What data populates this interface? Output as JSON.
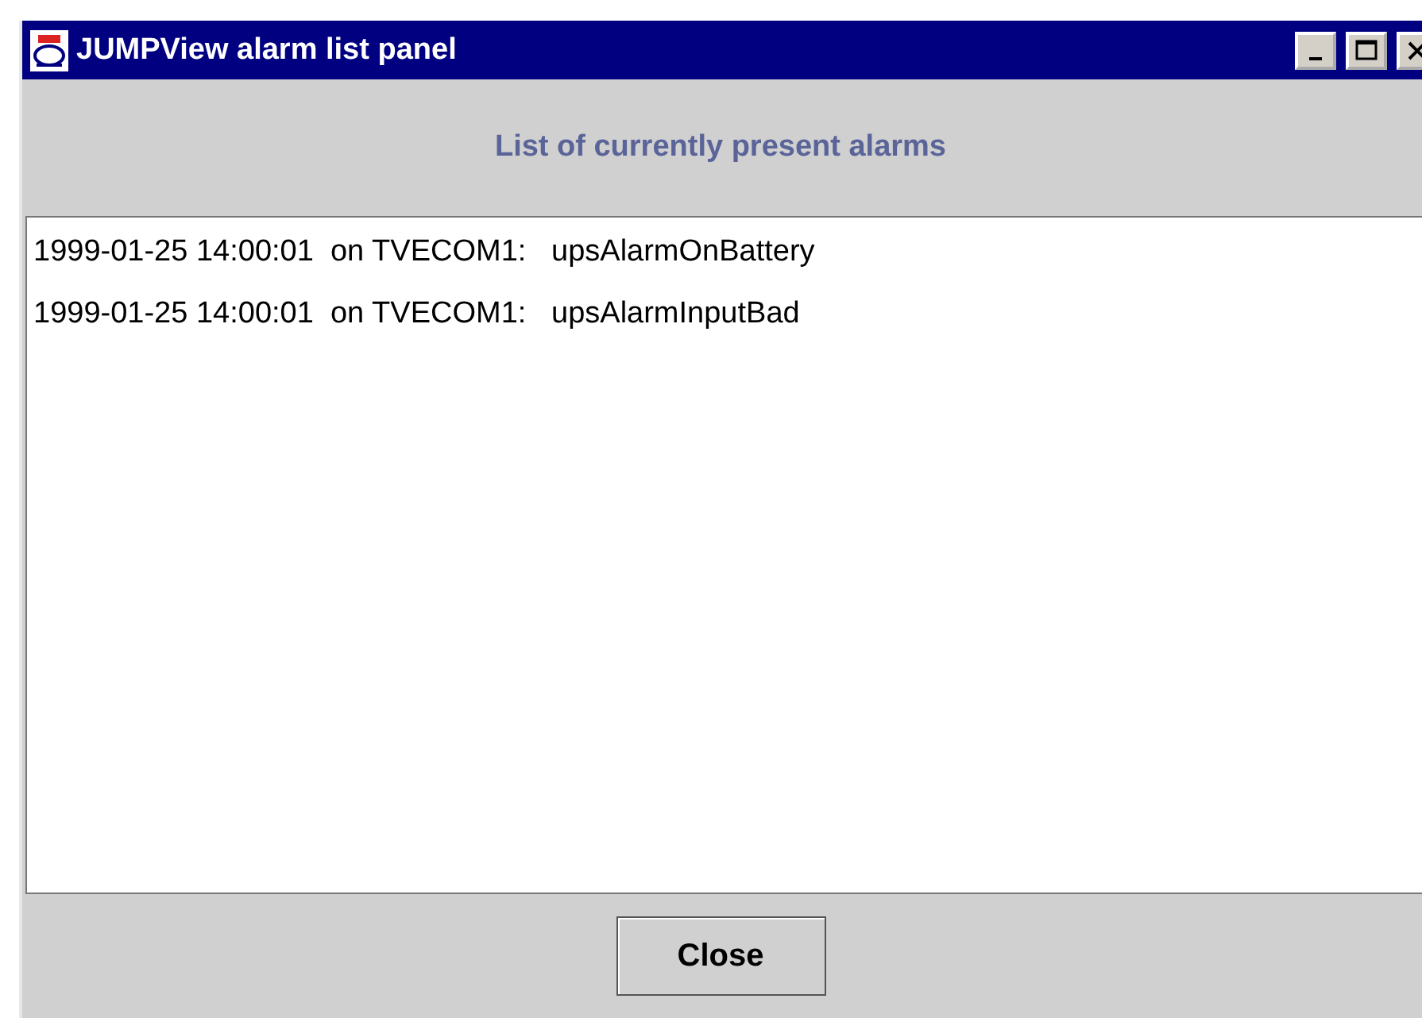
{
  "window": {
    "title": "JUMPView alarm list panel"
  },
  "heading": "List of currently present alarms",
  "alarms": [
    {
      "text": "1999-01-25 14:00:01  on TVECOM1:   upsAlarmOnBattery"
    },
    {
      "text": "1999-01-25 14:00:01  on TVECOM1:   upsAlarmInputBad"
    }
  ],
  "buttons": [
    "Close"
  ]
}
